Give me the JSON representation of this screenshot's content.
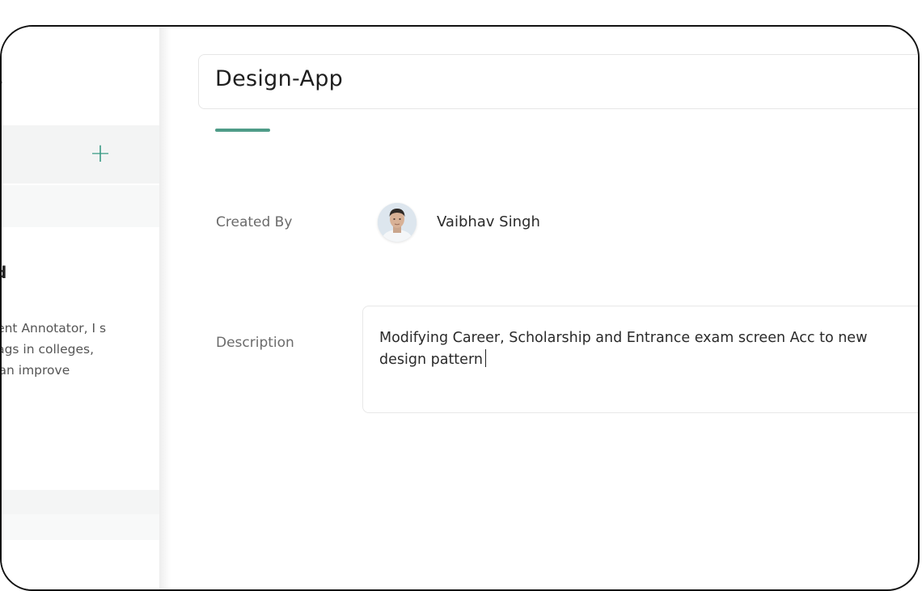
{
  "sidebar": {
    "heading_fragment": "s",
    "add_button_label": "+",
    "card": {
      "title_fragment": "d",
      "description_lines": [
        "tent Annotator, I s",
        " tags in colleges,",
        "can improve"
      ]
    }
  },
  "main": {
    "title": "Design-App",
    "fields": {
      "created_by_label": "Created By",
      "creator_name": "Vaibhav Singh",
      "description_label": "Description",
      "description_value": "Modifying Career, Scholarship and Entrance exam screen Acc to new design pattern"
    }
  },
  "colors": {
    "accent": "#4f9c88",
    "panel_bg": "#f3f4f4",
    "frame_border": "#111111"
  }
}
